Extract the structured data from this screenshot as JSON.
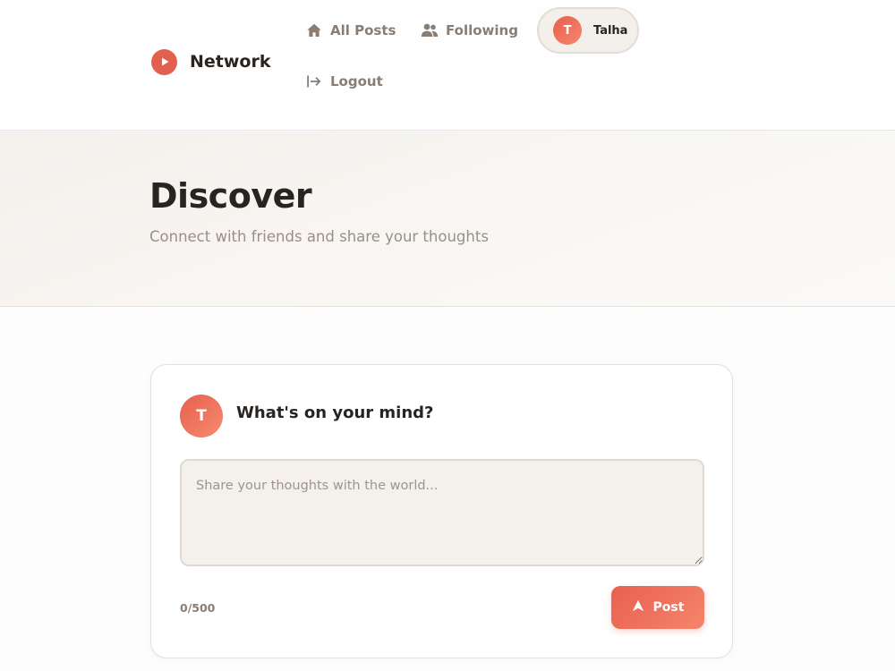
{
  "brand": {
    "name": "Network",
    "logo_icon": "play-icon",
    "accent": "#e2604f"
  },
  "nav": {
    "all_posts": {
      "label": "All Posts",
      "icon": "home-icon"
    },
    "following": {
      "label": "Following",
      "icon": "users-icon"
    },
    "logout": {
      "label": "Logout",
      "icon": "logout-icon"
    }
  },
  "user": {
    "initial": "T",
    "name": "Talha"
  },
  "hero": {
    "title": "Discover",
    "subtitle": "Connect with friends and share your thoughts"
  },
  "composer": {
    "avatar_initial": "T",
    "title": "What's on your mind?",
    "value": "",
    "placeholder": "Share your thoughts with the world...",
    "char_count": "0/500",
    "post_label": "Post",
    "post_icon": "send-icon"
  },
  "colors": {
    "accent": "#e8604f",
    "accent_light": "#f5856c",
    "text_dark": "#2a2420",
    "text_muted": "#8a7d73",
    "surface_beige": "#f4f0ec"
  }
}
